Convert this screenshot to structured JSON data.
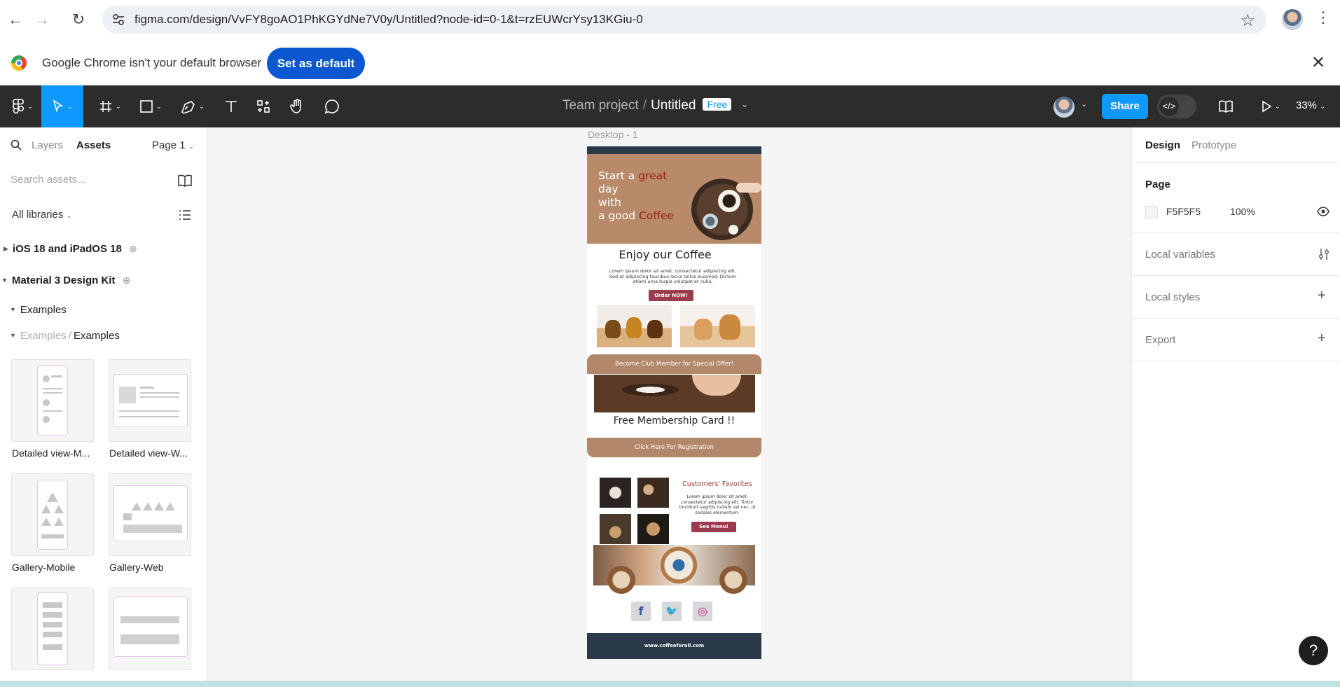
{
  "browser": {
    "url": "figma.com/design/VvFY8goAO1PhKGYdNe7V0y/Untitled?node-id=0-1&t=rzEUWcrYsy13KGiu-0",
    "infobar_text": "Google Chrome isn't your default browser",
    "set_default_label": "Set as default",
    "close_glyph": "✕"
  },
  "toolbar": {
    "team": "Team project",
    "separator": "/",
    "file": "Untitled",
    "plan_badge": "Free",
    "share_label": "Share",
    "devmode_glyph": "</>",
    "zoom": "33%"
  },
  "left_panel": {
    "tab_layers": "Layers",
    "tab_assets": "Assets",
    "page_select": "Page 1",
    "search_placeholder": "Search assets...",
    "all_libraries": "All libraries",
    "libraries": [
      "iOS 18 and iPadOS 18",
      "Material 3 Design Kit"
    ],
    "group_examples": "Examples",
    "path_parent": "Examples",
    "path_sep": "/",
    "path_current": "Examples",
    "thumbnails": [
      {
        "label": "Detailed view-M..."
      },
      {
        "label": "Detailed view-W..."
      },
      {
        "label": "Gallery-Mobile"
      },
      {
        "label": "Gallery-Web"
      }
    ]
  },
  "canvas": {
    "frame_label": "Desktop - 1",
    "design": {
      "hero_line1_a": "Start a ",
      "hero_line1_hl": "great",
      "hero_line1_b": " day",
      "hero_line2": "with",
      "hero_line3_a": "a good ",
      "hero_line3_hl": "Coffee",
      "enjoy_heading": "Enjoy our Coffee",
      "lorem1": "Lorem ipsum dolor sit amet, consectetur adipiscing elit. Sed at adipiscing faucibus lacus tellus euismod. Dictum etiam urna turpis volutpat et nulla.",
      "order_button": "Order NOW!",
      "club_banner": "Become Club Member for Special Offer!",
      "free_card": "Free Membership Card !!",
      "register_banner": "Click Here For Registration",
      "favorites_title": "Customers' Favorites",
      "lorem2": "Lorem ipsum dolor sit amet, consectetur adipiscing elit. Tortor tincidunt sagittis nullam vel nec, id sodales elementum.",
      "menu_button": "See Menu!",
      "social": {
        "facebook": "f",
        "twitter": "🐦",
        "instagram": "◎"
      },
      "footer_url": "www.coffeeforall.com"
    }
  },
  "right_panel": {
    "tab_design": "Design",
    "tab_prototype": "Prototype",
    "page_heading": "Page",
    "page_color": "F5F5F5",
    "page_opacity": "100%",
    "local_variables": "Local variables",
    "local_styles": "Local styles",
    "export": "Export",
    "add_glyph": "+"
  },
  "help_glyph": "?",
  "colors": {
    "accent": "#0d99ff",
    "toolbar_bg": "#2c2c2c",
    "chrome_button": "#0b57d0",
    "coffee_brown": "#b3876a",
    "berry": "#9b3b4e"
  }
}
